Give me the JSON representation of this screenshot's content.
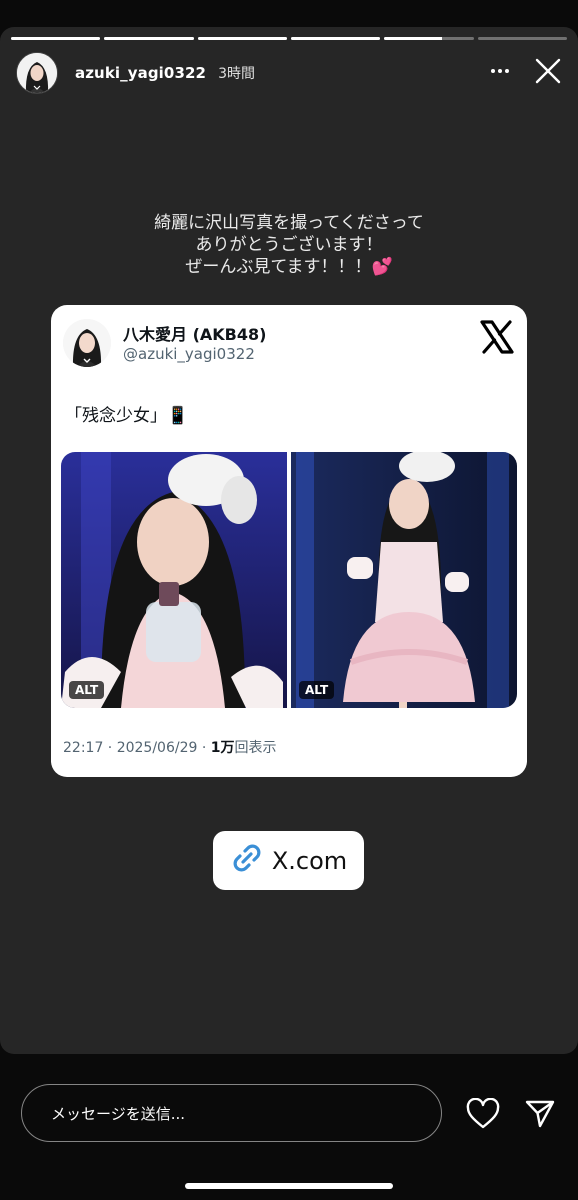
{
  "story": {
    "progress": [
      1,
      1,
      1,
      1,
      0.65,
      0
    ],
    "user": {
      "username": "azuki_yagi0322",
      "time": "3時間"
    },
    "caption": [
      "綺麗に沢山写真を撮ってくださって",
      "ありがとうございます！",
      "ぜーんぶ見てます！！！💕"
    ]
  },
  "post": {
    "name": "八木愛月 (AKB48)",
    "handle": "@azuki_yagi0322",
    "text": "「残念少女」📱",
    "photos": [
      {
        "alt_label": "ALT"
      },
      {
        "alt_label": "ALT"
      }
    ],
    "timestamp": "22:17 · 2025/06/29 · ",
    "views_count": "1万",
    "views_label": "回表示"
  },
  "link_sticker": {
    "label": "X.com",
    "color": "#3b8fd6"
  },
  "footer": {
    "reply_placeholder": "メッセージを送信..."
  },
  "colors": {
    "story_bg": "#262626",
    "page_bg": "#0a0a0a",
    "card_bg": "#ffffff"
  },
  "icons": [
    "more-icon",
    "close-icon",
    "x-logo-icon",
    "link-icon",
    "heart-icon",
    "send-icon"
  ]
}
